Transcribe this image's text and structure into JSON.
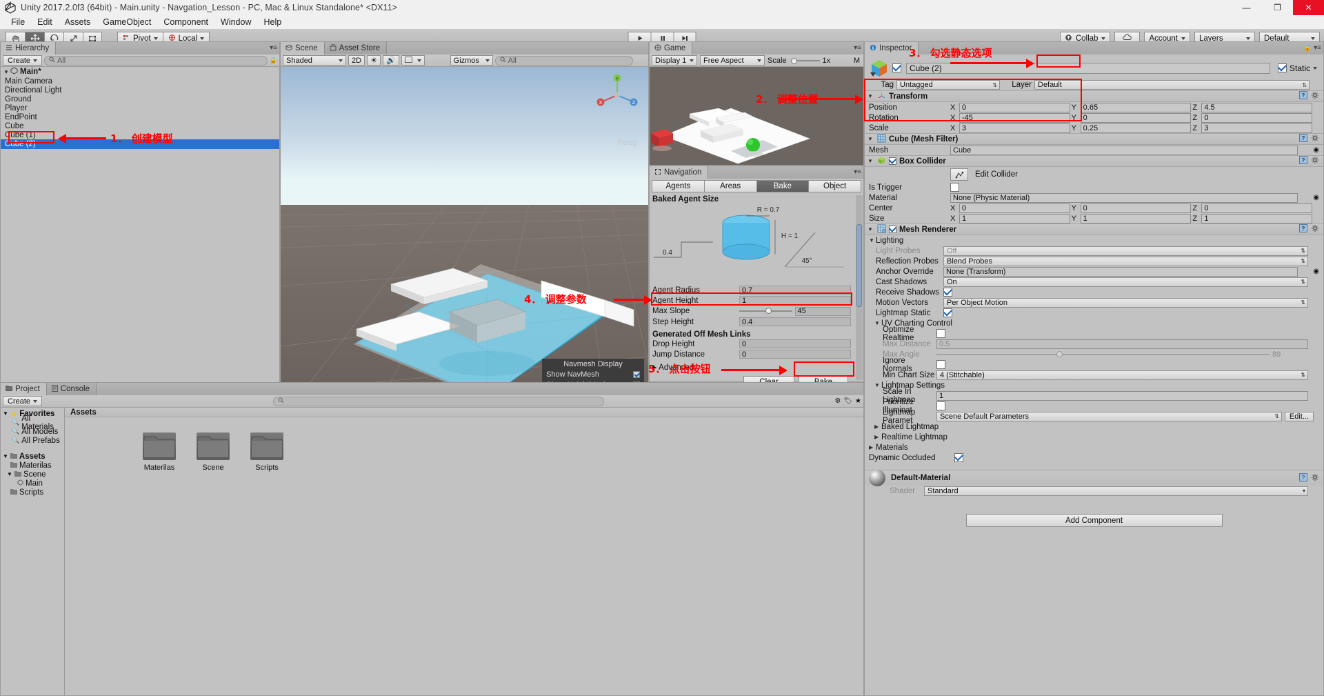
{
  "window": {
    "title": "Unity 2017.2.0f3 (64bit) - Main.unity - Navgation_Lesson - PC, Mac & Linux Standalone* <DX11>",
    "minimize": "—",
    "maximize": "❐",
    "close": "✕"
  },
  "menu": {
    "items": [
      "File",
      "Edit",
      "Assets",
      "GameObject",
      "Component",
      "Window",
      "Help"
    ]
  },
  "toolbar": {
    "pivot_label": "Pivot",
    "local_label": "Local",
    "collab_label": "Collab",
    "account_label": "Account",
    "layers_label": "Layers",
    "layout_label": "Default"
  },
  "hierarchy": {
    "tab": "Hierarchy",
    "create": "Create",
    "search_placeholder": "All",
    "root": "Main*",
    "items": [
      {
        "label": "Main Camera",
        "selected": false
      },
      {
        "label": "Directional Light",
        "selected": false
      },
      {
        "label": "Ground",
        "selected": false
      },
      {
        "label": "Player",
        "selected": false
      },
      {
        "label": "EndPoint",
        "selected": false
      },
      {
        "label": "Cube",
        "selected": false
      },
      {
        "label": "Cube (1)",
        "selected": false
      },
      {
        "label": "Cube (2)",
        "selected": true
      }
    ]
  },
  "scene": {
    "tabs": [
      "Scene",
      "Asset Store"
    ],
    "shading": "Shaded",
    "mode_2d": "2D",
    "gizmos": "Gizmos",
    "search_placeholder": "All",
    "persp_label": "Persp",
    "axis_labels": {
      "y": "Y",
      "x": "X",
      "z": "Z"
    }
  },
  "game": {
    "tab": "Game",
    "display": "Display 1",
    "aspect": "Free Aspect",
    "scale_label": "Scale",
    "scale_value": "1x",
    "maximize": "M"
  },
  "navigation": {
    "tab": "Navigation",
    "tabs": [
      "Agents",
      "Areas",
      "Bake",
      "Object"
    ],
    "active_tab": "Bake",
    "baked_agent_size": "Baked Agent Size",
    "diagram": {
      "radius_label": "R = 0.7",
      "height_label": "H = 1",
      "step_label": "0.4",
      "slope_label": "45°"
    },
    "fields": [
      {
        "label": "Agent Radius",
        "value": "0.7"
      },
      {
        "label": "Agent Height",
        "value": "1"
      },
      {
        "label": "Max Slope",
        "value": "45",
        "slider": true
      },
      {
        "label": "Step Height",
        "value": "0.4"
      }
    ],
    "offmesh_header": "Generated Off Mesh Links",
    "offmesh_fields": [
      {
        "label": "Drop Height",
        "value": "0"
      },
      {
        "label": "Jump Distance",
        "value": "0"
      }
    ],
    "advanced": "Advanced",
    "clear_button": "Clear",
    "bake_button": "Bake"
  },
  "navmesh_display": {
    "title": "Navmesh Display",
    "rows": [
      {
        "label": "Show NavMesh",
        "checked": true
      },
      {
        "label": "Show HeightMesh",
        "checked": false
      }
    ]
  },
  "inspector": {
    "tab": "Inspector",
    "object_name": "Cube (2)",
    "enabled": true,
    "static_label": "Static",
    "static_checked": true,
    "tag_label": "Tag",
    "tag_value": "Untagged",
    "layer_label": "Layer",
    "layer_value": "Default",
    "components": [
      {
        "name": "Transform",
        "rows": [
          {
            "label": "Position",
            "x": "0",
            "y": "0.65",
            "z": "4.5"
          },
          {
            "label": "Rotation",
            "x": "-45",
            "y": "0",
            "z": "0"
          },
          {
            "label": "Scale",
            "x": "3",
            "y": "0.25",
            "z": "3"
          }
        ]
      },
      {
        "name": "Cube (Mesh Filter)",
        "rows": [
          {
            "label": "Mesh",
            "value": "Cube"
          }
        ]
      },
      {
        "name": "Box Collider",
        "edit_collider": "Edit Collider",
        "rows": [
          {
            "label": "Is Trigger",
            "value": ""
          },
          {
            "label": "Material",
            "value": "None (Physic Material)"
          },
          {
            "label": "Center",
            "x": "0",
            "y": "0",
            "z": "0"
          },
          {
            "label": "Size",
            "x": "1",
            "y": "1",
            "z": "1"
          }
        ]
      },
      {
        "name": "Mesh Renderer",
        "lighting_header": "Lighting",
        "rows": [
          {
            "label": "Light Probes",
            "value": "Off",
            "disabled": true
          },
          {
            "label": "Reflection Probes",
            "value": "Blend Probes"
          },
          {
            "label": "Anchor Override",
            "value": "None (Transform)"
          },
          {
            "label": "Cast Shadows",
            "value": "On"
          },
          {
            "label": "Receive Shadows",
            "value": "",
            "checked": true
          },
          {
            "label": "Motion Vectors",
            "value": "Per Object Motion"
          },
          {
            "label": "Lightmap Static",
            "value": "",
            "checked": true
          }
        ],
        "uv_header": "UV Charting Control",
        "uv_rows": [
          {
            "label": "Optimize Realtime",
            "value": "",
            "checked": false
          },
          {
            "label": "Max Distance",
            "value": "0.5",
            "disabled": true
          },
          {
            "label": "Max Angle",
            "value": "89",
            "disabled": true,
            "slider": true
          },
          {
            "label": "Ignore Normals",
            "value": "",
            "checked": false
          },
          {
            "label": "Min Chart Size",
            "value": "4 (Stitchable)"
          }
        ],
        "lm_header": "Lightmap Settings",
        "lm_rows": [
          {
            "label": "Scale In Lightmap",
            "value": "1"
          },
          {
            "label": "Prioritize Illuminat",
            "value": "",
            "checked": false
          },
          {
            "label": "Lightmap Paramet",
            "value": "Scene Default Parameters",
            "button": "Edit..."
          }
        ],
        "collapsed": [
          "Baked Lightmap",
          "Realtime Lightmap"
        ],
        "materials_header": "Materials",
        "dynamic_occluded": {
          "label": "Dynamic Occluded",
          "checked": true
        }
      }
    ],
    "material": {
      "name": "Default-Material",
      "shader_label": "Shader",
      "shader_value": "Standard"
    },
    "add_component": "Add Component"
  },
  "project": {
    "tabs": [
      "Project",
      "Console"
    ],
    "create": "Create",
    "favorites": "Favorites",
    "favorite_items": [
      "All Materials",
      "All Models",
      "All Prefabs"
    ],
    "assets_root": "Assets",
    "tree": [
      {
        "label": "Assets",
        "depth": 0
      },
      {
        "label": "Materilas",
        "depth": 1
      },
      {
        "label": "Scene",
        "depth": 1
      },
      {
        "label": "Main",
        "depth": 2
      },
      {
        "label": "Scripts",
        "depth": 1
      }
    ],
    "content_header": "Assets",
    "items": [
      {
        "label": "Materilas"
      },
      {
        "label": "Scene"
      },
      {
        "label": "Scripts"
      }
    ]
  },
  "annotations": [
    {
      "id": "a1",
      "text": "1． 创建模型"
    },
    {
      "id": "a2",
      "text": "2． 调整位置"
    },
    {
      "id": "a3",
      "text": "3． 勾选静态选项"
    },
    {
      "id": "a4",
      "text": "4． 调整参数"
    },
    {
      "id": "a5",
      "text": "5． 点击按钮"
    }
  ],
  "colors": {
    "accent_red": "#ff0000",
    "selection_blue": "#2d6fd1",
    "panel_gray": "#c2c2c2"
  }
}
